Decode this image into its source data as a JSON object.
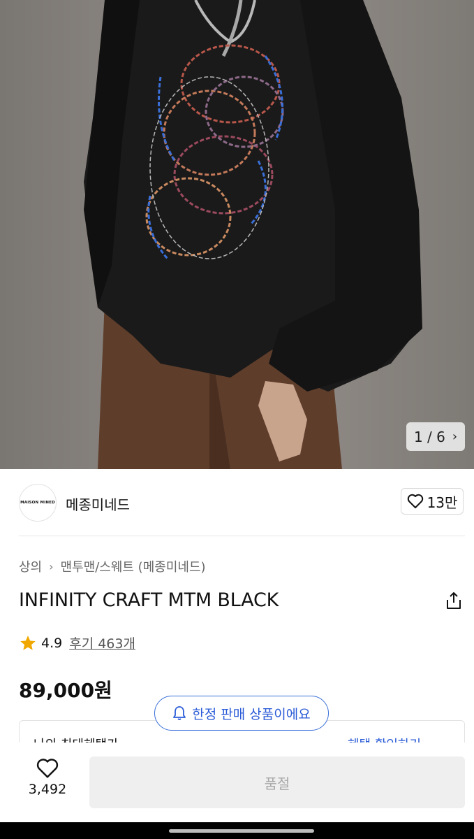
{
  "gallery": {
    "counter": "1 / 6"
  },
  "brand": {
    "logo_text": "MAISON MINED",
    "name": "메종미네드",
    "likes": "13만"
  },
  "breadcrumb": {
    "category": "상의",
    "subcategory": "맨투맨/스웨트 (메종미네드)"
  },
  "product": {
    "title": "INFINITY CRAFT MTM BLACK",
    "rating": "4.9",
    "reviews": "후기 463개",
    "price": "89,000원"
  },
  "benefit": {
    "left_label": "나의 최대혜택가",
    "right_label": "혜택 확인하기"
  },
  "limited_badge": {
    "label": "한정 판매 상품이에요"
  },
  "bottom": {
    "wish_count": "3,492",
    "buy_label": "품절"
  },
  "colors": {
    "accent": "#2a5bd7",
    "star": "#f0a800",
    "soldout_bg": "#efefef"
  }
}
